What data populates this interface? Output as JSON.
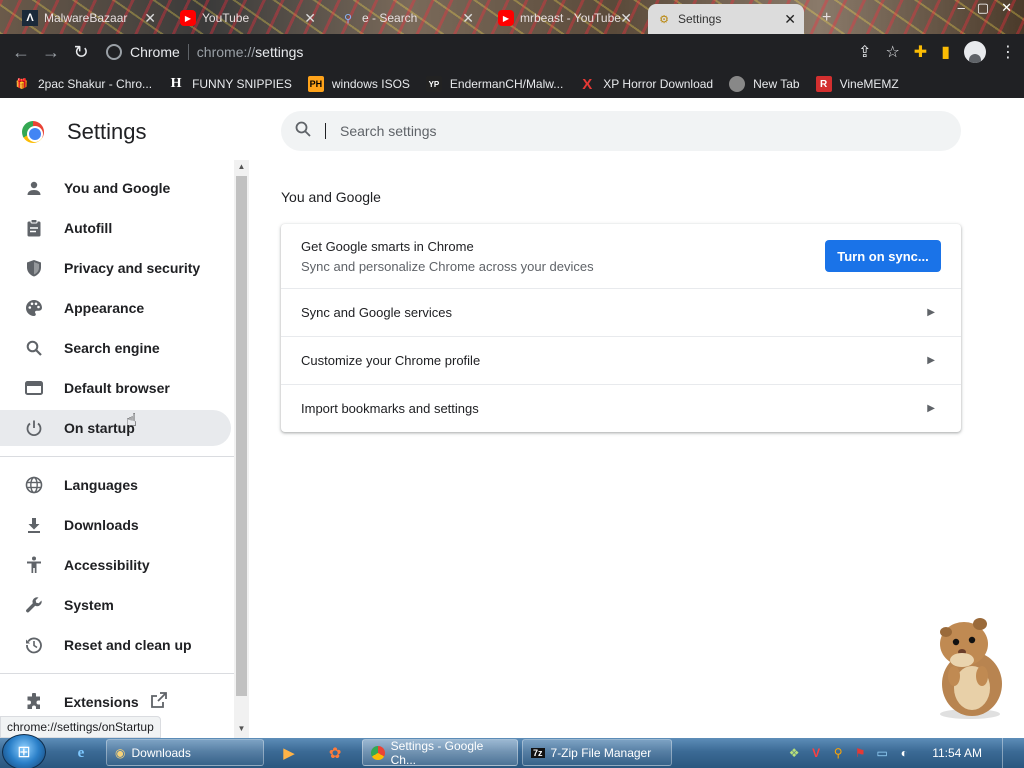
{
  "tabs": [
    {
      "label": "MalwareBazaar",
      "icon": "bazaar-icon"
    },
    {
      "label": "YouTube",
      "icon": "youtube-icon"
    },
    {
      "label": "e - Search",
      "icon": "search-icon"
    },
    {
      "label": "mrbeast - YouTube",
      "icon": "youtube-icon"
    },
    {
      "label": "Settings",
      "icon": "gear-icon",
      "active": true
    }
  ],
  "omnibox": {
    "site": "Chrome",
    "url_scheme": "chrome://",
    "url_path": "settings"
  },
  "bookmarks": [
    {
      "label": "2pac Shakur - Chro...",
      "icon": "gift-icon"
    },
    {
      "label": "FUNNY SNIPPIES",
      "icon": "h-icon",
      "glyph": "H"
    },
    {
      "label": "windows ISOS",
      "icon": "ph-icon",
      "glyph": "PH"
    },
    {
      "label": "EndermanCH/Malw...",
      "icon": "yp-icon",
      "glyph": "YP"
    },
    {
      "label": "XP Horror Download",
      "icon": "x-icon",
      "glyph": "X"
    },
    {
      "label": "New Tab",
      "icon": "newtab-icon"
    },
    {
      "label": "VineMEMZ",
      "icon": "r-icon",
      "glyph": "R"
    }
  ],
  "settings": {
    "title": "Settings",
    "search_placeholder": "Search settings",
    "nav": [
      {
        "label": "You and Google",
        "icon": "person-icon"
      },
      {
        "label": "Autofill",
        "icon": "clipboard-icon"
      },
      {
        "label": "Privacy and security",
        "icon": "shield-icon"
      },
      {
        "label": "Appearance",
        "icon": "palette-icon"
      },
      {
        "label": "Search engine",
        "icon": "search-icon"
      },
      {
        "label": "Default browser",
        "icon": "browser-icon"
      },
      {
        "label": "On startup",
        "icon": "power-icon"
      },
      {
        "label": "Languages",
        "icon": "globe-icon"
      },
      {
        "label": "Downloads",
        "icon": "download-icon"
      },
      {
        "label": "Accessibility",
        "icon": "accessibility-icon"
      },
      {
        "label": "System",
        "icon": "wrench-icon"
      },
      {
        "label": "Reset and clean up",
        "icon": "history-icon"
      },
      {
        "label": "Extensions",
        "icon": "puzzle-icon"
      }
    ],
    "section_title": "You and Google",
    "sync_card": {
      "title": "Get Google smarts in Chrome",
      "subtitle": "Sync and personalize Chrome across your devices",
      "button": "Turn on sync..."
    },
    "rows": [
      {
        "label": "Sync and Google services"
      },
      {
        "label": "Customize your Chrome profile"
      },
      {
        "label": "Import bookmarks and settings"
      }
    ]
  },
  "status_url": "chrome://settings/onStartup",
  "taskbar": {
    "tasks": [
      {
        "label": "Downloads",
        "icon": "explorer-icon"
      },
      {
        "label": "Settings - Google Ch...",
        "icon": "chrome-icon"
      },
      {
        "label": "7-Zip File Manager",
        "icon": "7zip-icon"
      }
    ],
    "clock": "11:54 AM"
  },
  "colors": {
    "accent": "#1a73e8",
    "hover": "#e8eaed",
    "toolbar": "#202124"
  }
}
